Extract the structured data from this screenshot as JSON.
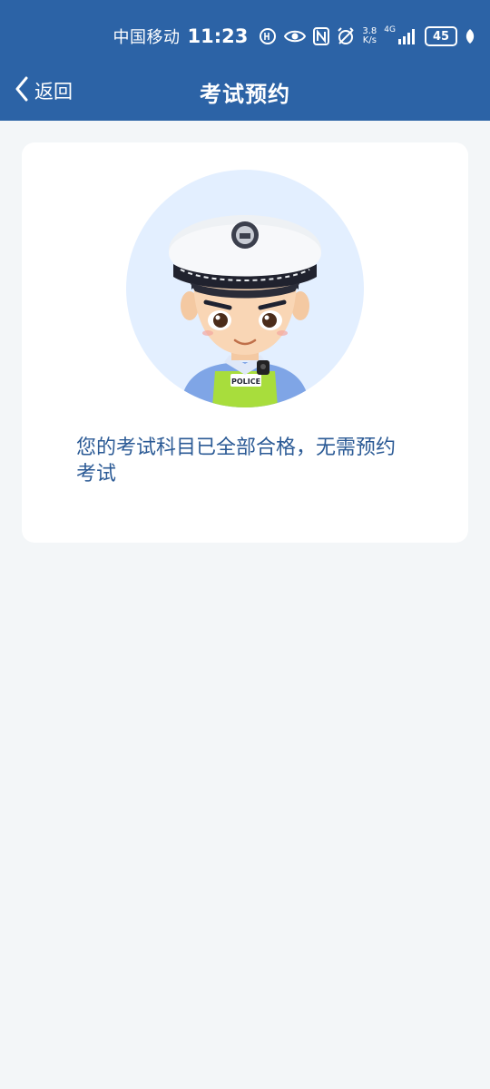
{
  "status_bar": {
    "carrier": "中国移动",
    "time": "11:23",
    "net_speed_value": "3.8",
    "net_speed_unit": "K/s",
    "network_type": "4G",
    "battery": "45"
  },
  "navbar": {
    "back_label": "返回",
    "title": "考试预约"
  },
  "card": {
    "avatar_badge_text": "POLICE",
    "message": "您的考试科目已全部合格，无需预约考试"
  },
  "colors": {
    "header_bg": "#2c63a6",
    "page_bg": "#f3f6f8",
    "message_text": "#2b5a95",
    "avatar_circle": "#e3efff"
  },
  "icons": [
    "chevron-left-icon",
    "nfc-icon",
    "eye-icon",
    "alarm-icon",
    "signal-icon",
    "battery-icon",
    "leaf-icon",
    "hd-icon"
  ]
}
